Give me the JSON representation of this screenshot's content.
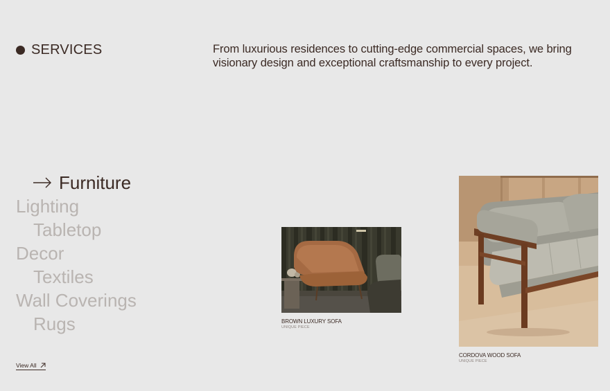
{
  "section": {
    "title": "SERVICES"
  },
  "intro": "From luxurious residences to cutting-edge commercial spaces, we bring visionary design and exceptional craftsmanship to every project.",
  "services": [
    {
      "label": "Furniture"
    },
    {
      "label": "Lighting"
    },
    {
      "label": "Tabletop"
    },
    {
      "label": "Decor"
    },
    {
      "label": "Textiles"
    },
    {
      "label": "Wall Coverings"
    },
    {
      "label": "Rugs"
    }
  ],
  "products": [
    {
      "name": "BROWN LUXURY SOFA",
      "tag": "UNIQUE PIECE"
    },
    {
      "name": "CORDOVA WOOD SOFA",
      "tag": "UNIQUE PIECE"
    }
  ],
  "view_all": "View All",
  "icons": {
    "bullet": "dot-icon",
    "active_service": "arrow-right-icon",
    "view_all": "arrow-up-right-icon"
  },
  "colors": {
    "background": "#e8e8e8",
    "text": "#3b2a24",
    "inactive": "#b9b4b1",
    "muted": "#8e8480"
  }
}
